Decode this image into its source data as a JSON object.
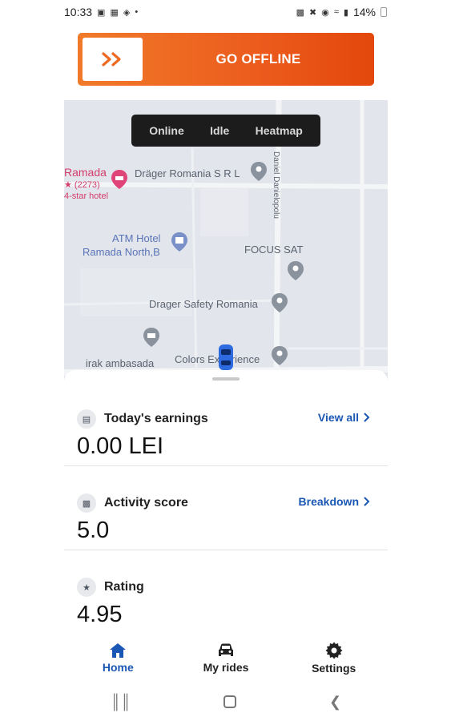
{
  "status_bar": {
    "time": "10:33",
    "battery": "14%"
  },
  "go_offline": {
    "label": "GO OFFLINE",
    "colors": {
      "start": "#f07a2a",
      "end": "#e3470c"
    }
  },
  "map": {
    "tabs": [
      "Online",
      "Idle",
      "Heatmap"
    ],
    "pois": {
      "ramada": "Ramada",
      "ramada_rating": "★ (2273)",
      "ramada_class": "4-star hotel",
      "drager_romania": "Dräger Romania S R L",
      "atm_hotel_1": "ATM Hotel",
      "atm_hotel_2": "Ramada North,B",
      "focus_sat": "FOCUS SAT",
      "drager_safety": "Drager Safety Romania",
      "irak": "irak ambasada",
      "colors_exp": "Colors Experience",
      "street": "Daniel Danielopolu"
    }
  },
  "cards": {
    "earnings": {
      "title": "Today's earnings",
      "value": "0.00 LEI",
      "link": "View all"
    },
    "activity": {
      "title": "Activity score",
      "value": "5.0",
      "link": "Breakdown"
    },
    "rating": {
      "title": "Rating",
      "value": "4.95"
    }
  },
  "nav": {
    "home": "Home",
    "rides": "My rides",
    "settings": "Settings"
  },
  "accent": "#1a57b4"
}
